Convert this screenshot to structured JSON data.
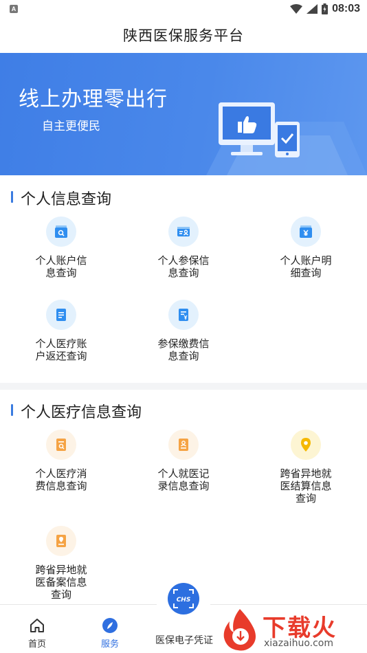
{
  "status_bar": {
    "time": "08:03",
    "left_badge": "A"
  },
  "header": {
    "title": "陕西医保服务平台"
  },
  "banner": {
    "title": "线上办理零出行",
    "subtitle": "自主更便民"
  },
  "sections": [
    {
      "title": "个人信息查询",
      "items": [
        {
          "label_line1": "个人账户信",
          "label_line2": "息查询",
          "label_line3": ""
        },
        {
          "label_line1": "个人参保信",
          "label_line2": "息查询",
          "label_line3": ""
        },
        {
          "label_line1": "个人账户明",
          "label_line2": "细查询",
          "label_line3": ""
        },
        {
          "label_line1": "个人医疗账",
          "label_line2": "户返还查询",
          "label_line3": ""
        },
        {
          "label_line1": "参保缴费信",
          "label_line2": "息查询",
          "label_line3": ""
        }
      ]
    },
    {
      "title": "个人医疗信息查询",
      "items": [
        {
          "label_line1": "个人医疗消",
          "label_line2": "费信息查询",
          "label_line3": ""
        },
        {
          "label_line1": "个人就医记",
          "label_line2": "录信息查询",
          "label_line3": ""
        },
        {
          "label_line1": "跨省异地就",
          "label_line2": "医结算信息",
          "label_line3": "查询"
        },
        {
          "label_line1": "跨省异地就",
          "label_line2": "医备案信息",
          "label_line3": "查询"
        }
      ]
    }
  ],
  "bottom_nav": {
    "home": "首页",
    "service": "服务",
    "center": "医保电子凭证",
    "center_badge": "CHS"
  },
  "watermark": {
    "brand": "下载火",
    "url": "xiazaihuo.com"
  },
  "colors": {
    "accent": "#2f6fe0",
    "banner": "#4a88ea",
    "watermark": "#e83b2b"
  }
}
